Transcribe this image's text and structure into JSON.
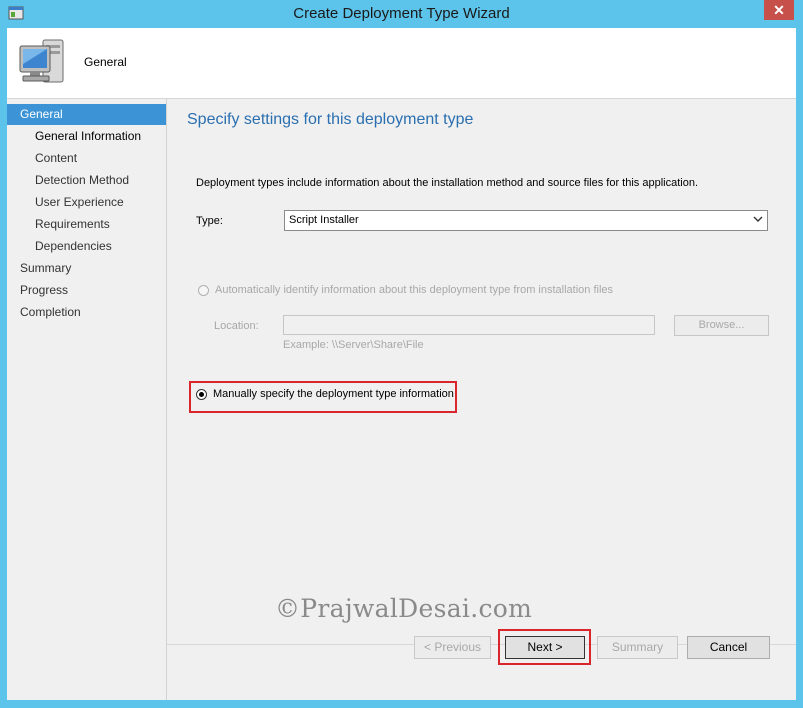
{
  "window": {
    "title": "Create Deployment Type Wizard",
    "close_label": "✕",
    "accent_color": "#5cc3ea"
  },
  "header": {
    "title": "General",
    "icon": "computer-icon"
  },
  "sidebar": {
    "items": [
      {
        "label": "General",
        "level": "top",
        "active": true
      },
      {
        "label": "General Information",
        "level": "sub",
        "bold": true
      },
      {
        "label": "Content",
        "level": "sub"
      },
      {
        "label": "Detection Method",
        "level": "sub"
      },
      {
        "label": "User Experience",
        "level": "sub"
      },
      {
        "label": "Requirements",
        "level": "sub"
      },
      {
        "label": "Dependencies",
        "level": "sub"
      },
      {
        "label": "Summary",
        "level": "top"
      },
      {
        "label": "Progress",
        "level": "top"
      },
      {
        "label": "Completion",
        "level": "top"
      }
    ]
  },
  "main": {
    "heading": "Specify settings for this deployment type",
    "description": "Deployment types include information about the installation method and source files for this application.",
    "type_label": "Type:",
    "type_value": "Script Installer",
    "auto_option": "Automatically identify information about this deployment type from installation files",
    "location_label": "Location:",
    "location_value": "",
    "browse_label": "Browse...",
    "example_text": "Example: \\\\Server\\Share\\File",
    "manual_option": "Manually specify the deployment type information"
  },
  "footer": {
    "previous_label": "< Previous",
    "next_label": "Next >",
    "summary_label": "Summary",
    "cancel_label": "Cancel",
    "watermark": "©PrajwalDesai.com"
  }
}
